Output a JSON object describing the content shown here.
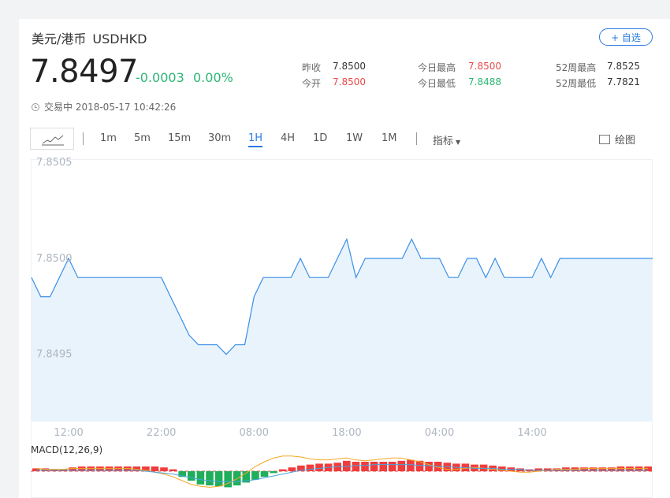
{
  "header": {
    "name": "美元/港币",
    "code": "USDHKD",
    "watch_label": "+ 自选",
    "price": "7.8497",
    "change": "-0.0003",
    "change_pct": "0.00%"
  },
  "stats": {
    "prev_close_label": "昨收",
    "prev_close": "7.8500",
    "open_label": "今开",
    "open": "7.8500",
    "high_label": "今日最高",
    "high": "7.8500",
    "low_label": "今日最低",
    "low": "7.8488",
    "w52_high_label": "52周最高",
    "w52_high": "7.8525",
    "w52_low_label": "52周最低",
    "w52_low": "7.7821"
  },
  "status": {
    "text": "交易中 2018-05-17 10:42:26"
  },
  "toolbar": {
    "periods": [
      "1m",
      "5m",
      "15m",
      "30m",
      "1H",
      "4H",
      "1D",
      "1W",
      "1M"
    ],
    "active_period": "1H",
    "indicator_label": "指标",
    "draw_label": "绘图"
  },
  "colors": {
    "line": "#3a8ee6",
    "fill": "#e9f3fc",
    "up": "#f03c3c",
    "down": "#1fae5a",
    "dif": "#4aa3df",
    "dea": "#f5a623",
    "accent": "#2a7ae2"
  },
  "chart_data": [
    {
      "type": "area",
      "title": "",
      "yticks": [
        "7.8505",
        "7.8500",
        "7.8495"
      ],
      "ylim": [
        7.84915,
        7.8505
      ],
      "xticks": [
        {
          "label": "12:00",
          "index": 4
        },
        {
          "label": "22:00",
          "index": 14
        },
        {
          "label": "08:00",
          "index": 24
        },
        {
          "label": "18:00",
          "index": 34
        },
        {
          "label": "04:00",
          "index": 44
        },
        {
          "label": "14:00",
          "index": 54
        }
      ],
      "values": [
        7.8499,
        7.8498,
        7.8498,
        7.8499,
        7.85,
        7.8499,
        7.8499,
        7.8499,
        7.8499,
        7.8499,
        7.8499,
        7.8499,
        7.8499,
        7.8499,
        7.8499,
        7.8498,
        7.8497,
        7.8496,
        7.84955,
        7.84955,
        7.84955,
        7.8495,
        7.84955,
        7.84955,
        7.8498,
        7.8499,
        7.8499,
        7.8499,
        7.8499,
        7.85,
        7.8499,
        7.8499,
        7.8499,
        7.85,
        7.8501,
        7.8499,
        7.85,
        7.85,
        7.85,
        7.85,
        7.85,
        7.8501,
        7.85,
        7.85,
        7.85,
        7.8499,
        7.8499,
        7.85,
        7.85,
        7.8499,
        7.85,
        7.8499,
        7.8499,
        7.8499,
        7.8499,
        7.85,
        7.8499,
        7.85,
        7.85,
        7.85,
        7.85,
        7.85,
        7.85,
        7.85,
        7.85,
        7.85,
        7.85,
        7.85
      ]
    },
    {
      "type": "bar",
      "title": "MACD(12,26,9)",
      "macd": [
        0.3,
        0.3,
        0.2,
        0.2,
        0.4,
        0.5,
        0.5,
        0.5,
        0.5,
        0.5,
        0.5,
        0.5,
        0.5,
        0.5,
        0.4,
        0.2,
        -0.6,
        -1.0,
        -1.4,
        -1.5,
        -1.6,
        -1.7,
        -1.5,
        -1.2,
        -0.9,
        -0.6,
        -0.2,
        0.2,
        0.4,
        0.6,
        0.7,
        0.8,
        0.8,
        0.9,
        1.1,
        1.0,
        1.0,
        1.0,
        1.0,
        1.0,
        1.1,
        1.2,
        1.1,
        1.0,
        1.0,
        0.9,
        0.8,
        0.8,
        0.7,
        0.7,
        0.6,
        0.5,
        0.4,
        0.3,
        0.2,
        0.3,
        0.3,
        0.3,
        0.4,
        0.4,
        0.4,
        0.4,
        0.4,
        0.4,
        0.5,
        0.5,
        0.5,
        0.5
      ],
      "dif": [
        0.3,
        0.2,
        0.2,
        0.2,
        0.3,
        0.3,
        0.3,
        0.3,
        0.3,
        0.3,
        0.3,
        0.2,
        0.1,
        -0.1,
        -0.3,
        -0.6,
        -1.0,
        -1.4,
        -1.6,
        -1.7,
        -1.6,
        -1.3,
        -0.8,
        -0.2,
        0.5,
        1.0,
        1.4,
        1.6,
        1.6,
        1.5,
        1.3,
        1.2,
        1.2,
        1.3,
        1.4,
        1.2,
        1.1,
        1.2,
        1.3,
        1.4,
        1.4,
        1.2,
        1.0,
        0.7,
        0.4,
        0.2,
        0.2,
        0.3,
        0.4,
        0.3,
        0.2,
        0.1,
        0.0,
        -0.1,
        -0.1,
        0.0,
        0.1,
        0.2,
        0.2,
        0.2,
        0.3,
        0.3,
        0.3,
        0.3,
        0.3,
        0.3,
        0.3,
        0.3
      ],
      "dea": [
        0.1,
        0.1,
        0.1,
        0.1,
        0.1,
        0.1,
        0.1,
        0.1,
        0.1,
        0.1,
        0.1,
        0.1,
        0.0,
        -0.1,
        -0.2,
        -0.3,
        -0.5,
        -0.7,
        -0.9,
        -1.0,
        -1.1,
        -1.1,
        -1.1,
        -1.0,
        -0.9,
        -0.7,
        -0.5,
        -0.3,
        -0.1,
        0.1,
        0.2,
        0.3,
        0.4,
        0.5,
        0.5,
        0.6,
        0.6,
        0.7,
        0.7,
        0.7,
        0.7,
        0.7,
        0.6,
        0.6,
        0.5,
        0.5,
        0.4,
        0.4,
        0.3,
        0.3,
        0.3,
        0.2,
        0.2,
        0.2,
        0.1,
        0.1,
        0.1,
        0.1,
        0.1,
        0.1,
        0.1,
        0.1,
        0.1,
        0.1,
        0.1,
        0.1,
        0.1,
        0.1
      ]
    }
  ]
}
